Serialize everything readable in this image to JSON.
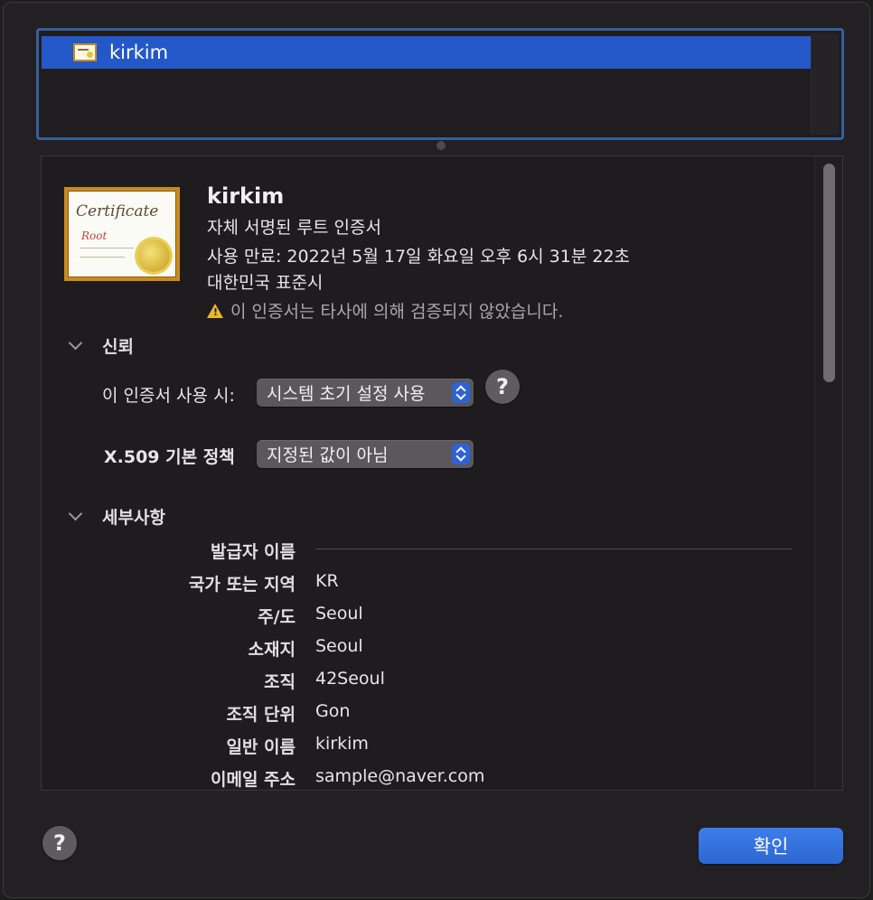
{
  "cert_list": {
    "items": [
      {
        "label": "kirkim",
        "icon": "certificate-icon"
      }
    ]
  },
  "header": {
    "name": "kirkim",
    "kind": "자체 서명된 루트 인증서",
    "expires": "사용 만료: 2022년 5월 17일 화요일 오후 6시 31분 22초",
    "timezone": "대한민국 표준시",
    "warning": "이 인증서는 타사에 의해 검증되지 않았습니다.",
    "cert_badge_title": "Certificate",
    "cert_badge_sub": "Root"
  },
  "trust": {
    "section_title": "신뢰",
    "when_using_label": "이 인증서 사용 시:",
    "when_using_value": "시스템 초기 설정 사용",
    "x509_label": "X.509 기본 정책",
    "x509_value": "지정된 값이 아님",
    "help": "?"
  },
  "details": {
    "section_title": "세부사항",
    "issuer_heading": "발급자 이름",
    "rows": [
      {
        "key": "국가 또는 지역",
        "value": "KR"
      },
      {
        "key": "주/도",
        "value": "Seoul"
      },
      {
        "key": "소재지",
        "value": "Seoul"
      },
      {
        "key": "조직",
        "value": "42Seoul"
      },
      {
        "key": "조직 단위",
        "value": "Gon"
      },
      {
        "key": "일반 이름",
        "value": "kirkim"
      },
      {
        "key": "이메일 주소",
        "value": "sample@naver.com"
      }
    ]
  },
  "footer": {
    "help": "?",
    "ok_label": "확인"
  },
  "colors": {
    "selection": "#2458c8",
    "accent": "#2f62d6",
    "warning": "#e7b830"
  }
}
